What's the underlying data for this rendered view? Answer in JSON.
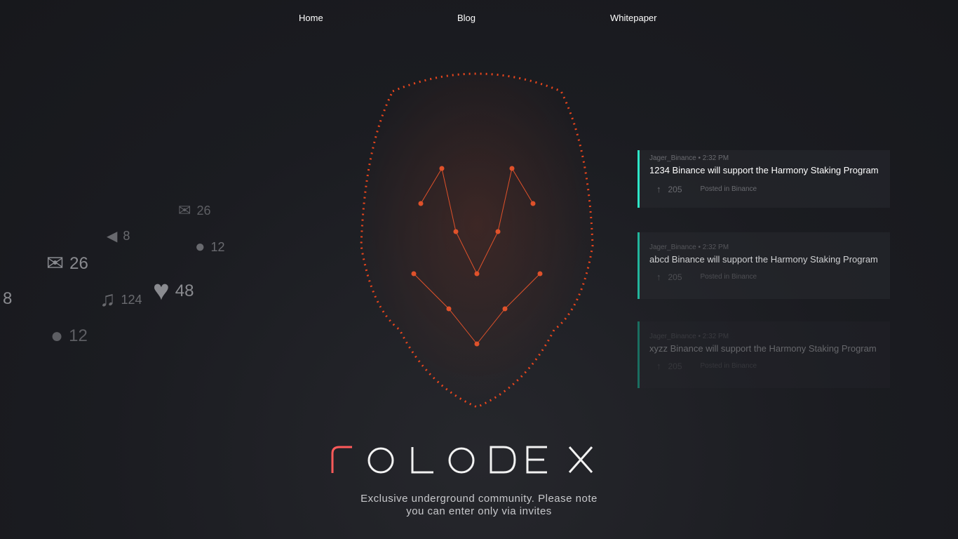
{
  "nav": {
    "home": "Home",
    "blog": "Blog",
    "whitepaper": "Whitepaper"
  },
  "decor": [
    {
      "icon": "mail-icon",
      "glyph": "✉",
      "count": "26"
    },
    {
      "icon": "mail-icon",
      "glyph": "✉",
      "count": "26"
    },
    {
      "icon": "megaphone-icon",
      "glyph": "📢",
      "count": "8"
    },
    {
      "icon": "user-icon",
      "glyph": "👤",
      "count": "12"
    },
    {
      "icon": "user-icon",
      "glyph": "👤",
      "count": "12"
    },
    {
      "icon": "music-icon",
      "glyph": "♫",
      "count": "124"
    },
    {
      "icon": "heart-icon",
      "glyph": "♥",
      "count": "48"
    },
    {
      "icon": "count",
      "glyph": "",
      "count": "8"
    }
  ],
  "posts": [
    {
      "author": "Jager_Binance",
      "time": "2:32 PM",
      "title": "1234 Binance will support the Harmony Staking Program",
      "votes": "205",
      "posted": "Posted in Binance"
    },
    {
      "author": "Jager_Binance",
      "time": "2:32 PM",
      "title": "abcd Binance will support the Harmony Staking Program",
      "votes": "205",
      "posted": "Posted in Binance"
    },
    {
      "author": "Jager_Binance",
      "time": "2:32 PM",
      "title": "xyzz Binance will support the Harmony Staking Program",
      "votes": "205",
      "posted": "Posted in Binance"
    }
  ],
  "logo": "rolodex",
  "tagline": {
    "line1": "Exclusive underground community. Please note",
    "line2": "you can enter only via invites"
  },
  "colors": {
    "accent": "#2ee6c8",
    "brand": "#ff5a3c"
  }
}
